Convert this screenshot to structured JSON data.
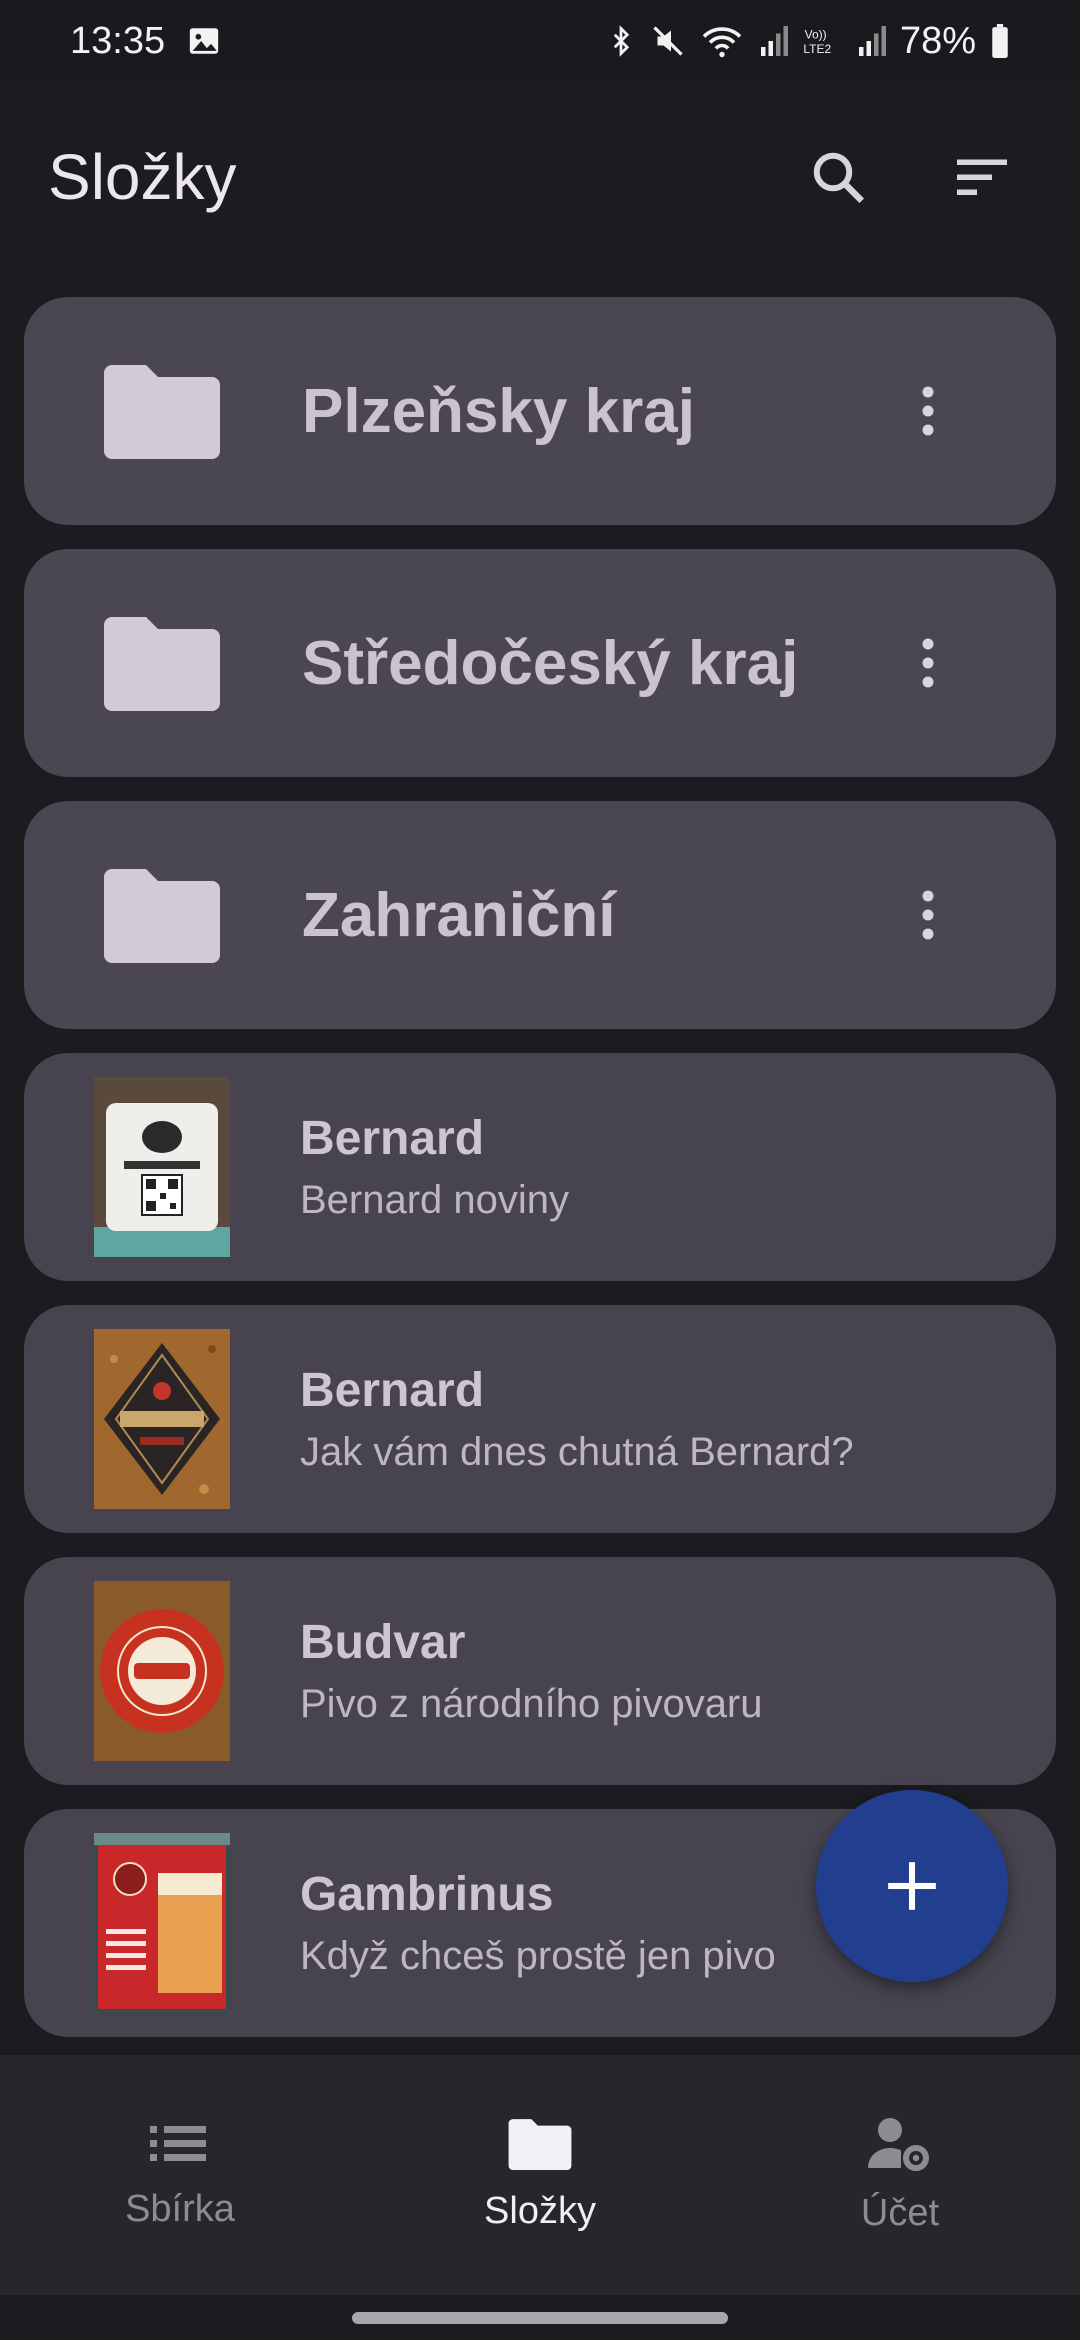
{
  "status": {
    "time": "13:35",
    "battery": "78%",
    "icons": [
      "gallery-icon",
      "bluetooth-icon",
      "mute-icon",
      "wifi-icon",
      "signal-icon",
      "lte-icon",
      "battery-icon"
    ]
  },
  "app_bar": {
    "title": "Složky",
    "actions": [
      "search-icon",
      "sort-icon"
    ]
  },
  "folders": [
    {
      "name": "Plzeňsky kraj"
    },
    {
      "name": "Středočeský kraj"
    },
    {
      "name": "Zahraniční"
    }
  ],
  "items": [
    {
      "title": "Bernard",
      "subtitle": "Bernard noviny",
      "thumb": "bernard-noviny-coaster"
    },
    {
      "title": "Bernard",
      "subtitle": "Jak vám dnes chutná Bernard?",
      "thumb": "bernard-1597-coaster"
    },
    {
      "title": "Budvar",
      "subtitle": "Pivo z národního pivovaru",
      "thumb": "budvar-coaster"
    },
    {
      "title": "Gambrinus",
      "subtitle": "Když chceš prostě jen pivo",
      "thumb": "gambrinus-coaster"
    }
  ],
  "fab": {
    "icon": "plus-icon"
  },
  "bottom_nav": [
    {
      "label": "Sbírka",
      "icon": "list-icon",
      "active": false
    },
    {
      "label": "Složky",
      "icon": "folder-icon",
      "active": true
    },
    {
      "label": "Účet",
      "icon": "account-settings-icon",
      "active": false
    }
  ],
  "colors": {
    "background": "#1c1b20",
    "card": "#4a4752",
    "fab": "#213e8f",
    "nav": "#27262b"
  }
}
